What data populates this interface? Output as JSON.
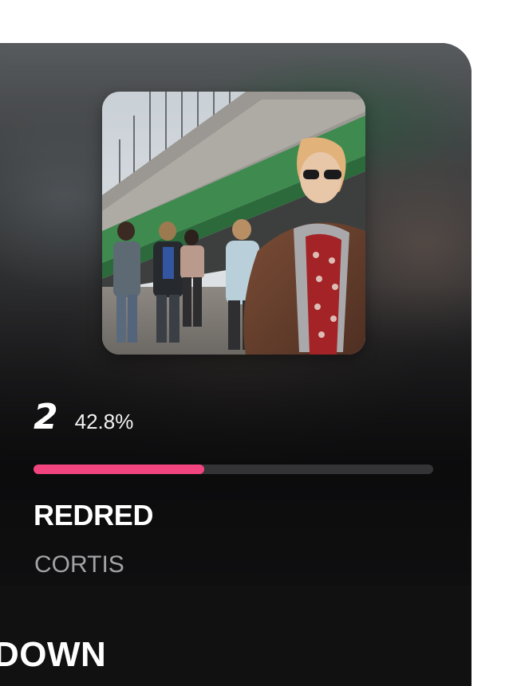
{
  "entry": {
    "rank": "2",
    "percent_text": "42.8%",
    "progress_fraction": 0.428,
    "title": "REDRED",
    "artist": "CORTIS"
  },
  "section": {
    "heading": "DOWN"
  },
  "colors": {
    "progress_fill": "#f2447e",
    "progress_track": "#343437",
    "card_background": "#121214",
    "artist_text": "#a3a3a6"
  },
  "icons": {
    "album_art": "album-cover-photo"
  }
}
